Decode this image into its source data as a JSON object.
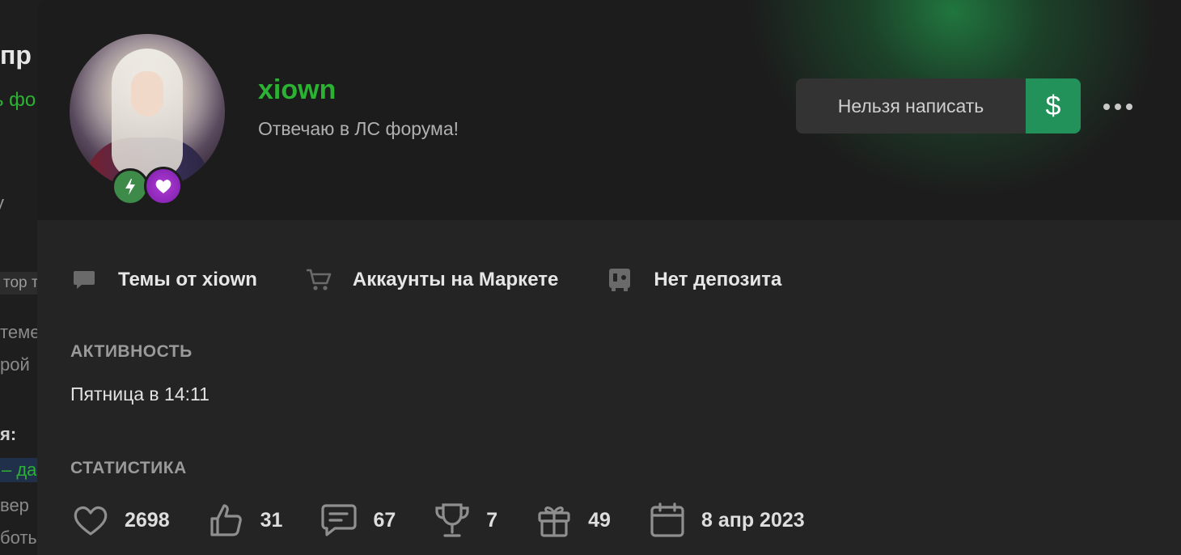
{
  "background_page": {
    "fragments": [
      "пр",
      "ь фо",
      "y",
      "тор т",
      "теме",
      "рой",
      "я:",
      "– да",
      "вер",
      "боты"
    ]
  },
  "profile": {
    "username": "xiown",
    "status": "Отвечаю в ЛС форума!",
    "badges": [
      "lightning-badge",
      "heart-badge"
    ],
    "actions": {
      "write_label": "Нельзя написать",
      "money_symbol": "$"
    }
  },
  "links": [
    {
      "label": "Темы от xiown",
      "icon": "chat-bubble-icon"
    },
    {
      "label": "Аккаунты на Маркете",
      "icon": "cart-icon"
    },
    {
      "label": "Нет депозита",
      "icon": "safe-icon"
    }
  ],
  "activity": {
    "title": "АКТИВНОСТЬ",
    "value": "Пятница в 14:11"
  },
  "statistics": {
    "title": "СТАТИСТИКА",
    "items": [
      {
        "icon": "heart-icon",
        "value": "2698"
      },
      {
        "icon": "thumbs-up-icon",
        "value": "31"
      },
      {
        "icon": "message-icon",
        "value": "67"
      },
      {
        "icon": "trophy-icon",
        "value": "7"
      },
      {
        "icon": "gift-icon",
        "value": "49"
      },
      {
        "icon": "calendar-icon",
        "value": "8 апр 2023"
      }
    ]
  },
  "colors": {
    "username": "#2bb233",
    "accent_green": "#22925a",
    "card_bg": "#242424",
    "header_bg": "#1c1c1c"
  }
}
